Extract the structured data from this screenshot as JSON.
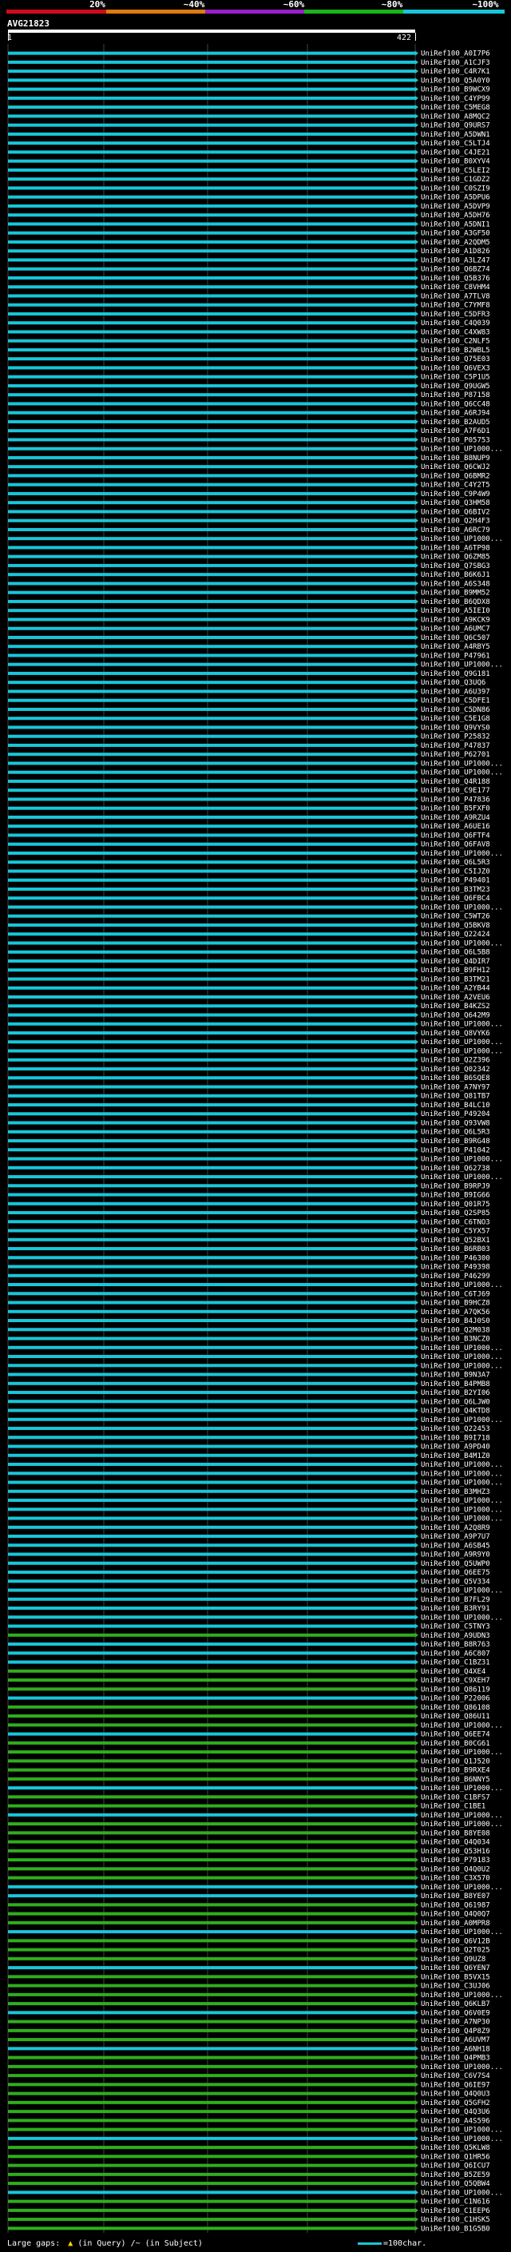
{
  "header": {
    "percent_labels": [
      "20%",
      "~40%",
      "~60%",
      "~80%",
      "~100%"
    ],
    "band_colors": [
      "#d20a1e",
      "#e07a10",
      "#9a1fc8",
      "#1bb31b",
      "#18c6d8"
    ],
    "query_name": "AVG21823",
    "query_start": "1",
    "query_end": "422"
  },
  "colors": {
    "cyan": "#18c6d8",
    "green": "#2fae1d",
    "dim": "#1c3f0e",
    "white": "#ffffff"
  },
  "hits": [
    {
      "name": "UniRef100_A0I7P6",
      "c": "c"
    },
    {
      "name": "UniRef100_A1CJF3",
      "c": "c"
    },
    {
      "name": "UniRef100_C4R7K1",
      "c": "c"
    },
    {
      "name": "UniRef100_Q5A0Y0",
      "c": "c"
    },
    {
      "name": "UniRef100_B9WCX9",
      "c": "c"
    },
    {
      "name": "UniRef100_C4YP99",
      "c": "c"
    },
    {
      "name": "UniRef100_C5MEG8",
      "c": "c"
    },
    {
      "name": "UniRef100_A8MQC2",
      "c": "c"
    },
    {
      "name": "UniRef100_Q9URS7",
      "c": "c"
    },
    {
      "name": "UniRef100_A5DWN1",
      "c": "c"
    },
    {
      "name": "UniRef100_C5LTJ4",
      "c": "c"
    },
    {
      "name": "UniRef100_C4JE21",
      "c": "c"
    },
    {
      "name": "UniRef100_B0XYV4",
      "c": "c"
    },
    {
      "name": "UniRef100_C5LEI2",
      "c": "c"
    },
    {
      "name": "UniRef100_C1GDZ2",
      "c": "c"
    },
    {
      "name": "UniRef100_C0SZI9",
      "c": "c"
    },
    {
      "name": "UniRef100_A5DPU6",
      "c": "c"
    },
    {
      "name": "UniRef100_A5DVP9",
      "c": "c"
    },
    {
      "name": "UniRef100_A5DH76",
      "c": "c"
    },
    {
      "name": "UniRef100_A5DNI1",
      "c": "c"
    },
    {
      "name": "UniRef100_A3GF50",
      "c": "c"
    },
    {
      "name": "UniRef100_A2QDM5",
      "c": "c"
    },
    {
      "name": "UniRef100_A1D826",
      "c": "c"
    },
    {
      "name": "UniRef100_A3LZ47",
      "c": "c"
    },
    {
      "name": "UniRef100_Q6BZ74",
      "c": "c"
    },
    {
      "name": "UniRef100_Q5B376",
      "c": "c"
    },
    {
      "name": "UniRef100_C8VHM4",
      "c": "c"
    },
    {
      "name": "UniRef100_A7TLV8",
      "c": "c"
    },
    {
      "name": "UniRef100_C7YMF8",
      "c": "c"
    },
    {
      "name": "UniRef100_C5DFR3",
      "c": "c"
    },
    {
      "name": "UniRef100_C4Q039",
      "c": "c"
    },
    {
      "name": "UniRef100_C4XW83",
      "c": "c"
    },
    {
      "name": "UniRef100_C2NLF5",
      "c": "c"
    },
    {
      "name": "UniRef100_B2WBL5",
      "c": "c"
    },
    {
      "name": "UniRef100_Q75E03",
      "c": "c"
    },
    {
      "name": "UniRef100_Q6VEX3",
      "c": "c"
    },
    {
      "name": "UniRef100_C5P1U5",
      "c": "c"
    },
    {
      "name": "UniRef100_Q9UGW5",
      "c": "c"
    },
    {
      "name": "UniRef100_P87158",
      "c": "c"
    },
    {
      "name": "UniRef100_Q6CC48",
      "c": "c"
    },
    {
      "name": "UniRef100_A6RJ94",
      "c": "c"
    },
    {
      "name": "UniRef100_B2AUD5",
      "c": "c"
    },
    {
      "name": "UniRef100_A7F6D1",
      "c": "c"
    },
    {
      "name": "UniRef100_P05753",
      "c": "c"
    },
    {
      "name": "UniRef100_UP1000...",
      "c": "c"
    },
    {
      "name": "UniRef100_B8NUP9",
      "c": "c"
    },
    {
      "name": "UniRef100_Q6CWJ2",
      "c": "c"
    },
    {
      "name": "UniRef100_Q6BMR2",
      "c": "c"
    },
    {
      "name": "UniRef100_C4Y2T5",
      "c": "c"
    },
    {
      "name": "UniRef100_C9P4W9",
      "c": "c"
    },
    {
      "name": "UniRef100_Q3HM58",
      "c": "c"
    },
    {
      "name": "UniRef100_Q6BIV2",
      "c": "c"
    },
    {
      "name": "UniRef100_Q2H4F3",
      "c": "c"
    },
    {
      "name": "UniRef100_A6RC79",
      "c": "c"
    },
    {
      "name": "UniRef100_UP1000...",
      "c": "c"
    },
    {
      "name": "UniRef100_A6TP98",
      "c": "c"
    },
    {
      "name": "UniRef100_Q6ZM85",
      "c": "c"
    },
    {
      "name": "UniRef100_Q7SBG3",
      "c": "c"
    },
    {
      "name": "UniRef100_B6K6J1",
      "c": "c"
    },
    {
      "name": "UniRef100_A6S348",
      "c": "c"
    },
    {
      "name": "UniRef100_B9MM52",
      "c": "c"
    },
    {
      "name": "UniRef100_B6QDX8",
      "c": "c"
    },
    {
      "name": "UniRef100_A5IEI0",
      "c": "c"
    },
    {
      "name": "UniRef100_A9KCK9",
      "c": "c"
    },
    {
      "name": "UniRef100_A6UMC7",
      "c": "c"
    },
    {
      "name": "UniRef100_Q6C507",
      "c": "c"
    },
    {
      "name": "UniRef100_A4RBY5",
      "c": "c"
    },
    {
      "name": "UniRef100_P47961",
      "c": "c"
    },
    {
      "name": "UniRef100_UP1000...",
      "c": "c"
    },
    {
      "name": "UniRef100_Q9G181",
      "c": "c"
    },
    {
      "name": "UniRef100_Q3UQ6",
      "c": "c"
    },
    {
      "name": "UniRef100_A6U397",
      "c": "c"
    },
    {
      "name": "UniRef100_C5DFE1",
      "c": "c"
    },
    {
      "name": "UniRef100_C5DN86",
      "c": "c"
    },
    {
      "name": "UniRef100_C5E1G8",
      "c": "c"
    },
    {
      "name": "UniRef100_Q9VYS0",
      "c": "c"
    },
    {
      "name": "UniRef100_P25832",
      "c": "c"
    },
    {
      "name": "UniRef100_P47837",
      "c": "c"
    },
    {
      "name": "UniRef100_P62701",
      "c": "c"
    },
    {
      "name": "UniRef100_UP1000...",
      "c": "c"
    },
    {
      "name": "UniRef100_UP1000...",
      "c": "c"
    },
    {
      "name": "UniRef100_Q4R188",
      "c": "c"
    },
    {
      "name": "UniRef100_C9E177",
      "c": "c"
    },
    {
      "name": "UniRef100_P47836",
      "c": "c"
    },
    {
      "name": "UniRef100_B5FXF0",
      "c": "c"
    },
    {
      "name": "UniRef100_A9RZU4",
      "c": "c"
    },
    {
      "name": "UniRef100_A6UE16",
      "c": "c"
    },
    {
      "name": "UniRef100_Q6FTF4",
      "c": "c"
    },
    {
      "name": "UniRef100_Q6FAV8",
      "c": "c"
    },
    {
      "name": "UniRef100_UP1000...",
      "c": "c"
    },
    {
      "name": "UniRef100_Q6L5R3",
      "c": "c"
    },
    {
      "name": "UniRef100_C5IJZ0",
      "c": "c"
    },
    {
      "name": "UniRef100_P49401",
      "c": "c"
    },
    {
      "name": "UniRef100_B3TM23",
      "c": "c"
    },
    {
      "name": "UniRef100_Q6FBC4",
      "c": "c"
    },
    {
      "name": "UniRef100_UP1000...",
      "c": "c"
    },
    {
      "name": "UniRef100_C5WT26",
      "c": "c"
    },
    {
      "name": "UniRef100_Q5BKV8",
      "c": "c"
    },
    {
      "name": "UniRef100_Q22424",
      "c": "c"
    },
    {
      "name": "UniRef100_UP1000...",
      "c": "c"
    },
    {
      "name": "UniRef100_Q6L5B8",
      "c": "c"
    },
    {
      "name": "UniRef100_Q4DIR7",
      "c": "c"
    },
    {
      "name": "UniRef100_B9FH12",
      "c": "c"
    },
    {
      "name": "UniRef100_B3TM21",
      "c": "c"
    },
    {
      "name": "UniRef100_A2YB44",
      "c": "c"
    },
    {
      "name": "UniRef100_A2VEU6",
      "c": "c"
    },
    {
      "name": "UniRef100_B4KZS2",
      "c": "c"
    },
    {
      "name": "UniRef100_Q642M9",
      "c": "c"
    },
    {
      "name": "UniRef100_UP1000...",
      "c": "c"
    },
    {
      "name": "UniRef100_Q8VYK6",
      "c": "c"
    },
    {
      "name": "UniRef100_UP1000...",
      "c": "c"
    },
    {
      "name": "UniRef100_UP1000...",
      "c": "c"
    },
    {
      "name": "UniRef100_Q2Z396",
      "c": "c"
    },
    {
      "name": "UniRef100_Q02342",
      "c": "c"
    },
    {
      "name": "UniRef100_B6SQE8",
      "c": "c"
    },
    {
      "name": "UniRef100_A7NY97",
      "c": "c"
    },
    {
      "name": "UniRef100_Q81TB7",
      "c": "c"
    },
    {
      "name": "UniRef100_B4LC10",
      "c": "c"
    },
    {
      "name": "UniRef100_P49204",
      "c": "c"
    },
    {
      "name": "UniRef100_Q93VW8",
      "c": "c"
    },
    {
      "name": "UniRef100_Q6L5R3",
      "c": "c"
    },
    {
      "name": "UniRef100_B9RG48",
      "c": "c"
    },
    {
      "name": "UniRef100_P41042",
      "c": "c"
    },
    {
      "name": "UniRef100_UP1000...",
      "c": "c"
    },
    {
      "name": "UniRef100_Q62738",
      "c": "c"
    },
    {
      "name": "UniRef100_UP1000...",
      "c": "c"
    },
    {
      "name": "UniRef100_B9RPJ9",
      "c": "c"
    },
    {
      "name": "UniRef100_B9IG66",
      "c": "c"
    },
    {
      "name": "UniRef100_Q01R75",
      "c": "c"
    },
    {
      "name": "UniRef100_Q2SP85",
      "c": "c"
    },
    {
      "name": "UniRef100_C6TNO3",
      "c": "c"
    },
    {
      "name": "UniRef100_C5YX57",
      "c": "c"
    },
    {
      "name": "UniRef100_Q52BX1",
      "c": "c"
    },
    {
      "name": "UniRef100_B6RB03",
      "c": "c"
    },
    {
      "name": "UniRef100_P46300",
      "c": "c"
    },
    {
      "name": "UniRef100_P49398",
      "c": "c"
    },
    {
      "name": "UniRef100_P46299",
      "c": "c"
    },
    {
      "name": "UniRef100_UP1000...",
      "c": "c"
    },
    {
      "name": "UniRef100_C6TJ69",
      "c": "c"
    },
    {
      "name": "UniRef100_B9HCZ8",
      "c": "c"
    },
    {
      "name": "UniRef100_A7QK56",
      "c": "c"
    },
    {
      "name": "UniRef100_B4J0S0",
      "c": "c"
    },
    {
      "name": "UniRef100_Q2M038",
      "c": "c"
    },
    {
      "name": "UniRef100_B3NCZ0",
      "c": "c"
    },
    {
      "name": "UniRef100_UP1000...",
      "c": "c"
    },
    {
      "name": "UniRef100_UP1000...",
      "c": "c"
    },
    {
      "name": "UniRef100_UP1000...",
      "c": "c"
    },
    {
      "name": "UniRef100_B9N3A7",
      "c": "c"
    },
    {
      "name": "UniRef100_B4PMB8",
      "c": "c"
    },
    {
      "name": "UniRef100_B2YI06",
      "c": "c"
    },
    {
      "name": "UniRef100_Q6LJW0",
      "c": "c"
    },
    {
      "name": "UniRef100_Q4KTD8",
      "c": "c"
    },
    {
      "name": "UniRef100_UP1000...",
      "c": "c"
    },
    {
      "name": "UniRef100_Q22453",
      "c": "c"
    },
    {
      "name": "UniRef100_B9I718",
      "c": "c"
    },
    {
      "name": "UniRef100_A9PD40",
      "c": "c"
    },
    {
      "name": "UniRef100_B4M1Z0",
      "c": "c"
    },
    {
      "name": "UniRef100_UP1000...",
      "c": "c"
    },
    {
      "name": "UniRef100_UP1000...",
      "c": "c"
    },
    {
      "name": "UniRef100_UP1000...",
      "c": "c"
    },
    {
      "name": "UniRef100_B3MHZ3",
      "c": "c"
    },
    {
      "name": "UniRef100_UP1000...",
      "c": "c"
    },
    {
      "name": "UniRef100_UP1000...",
      "c": "c"
    },
    {
      "name": "UniRef100_UP1000...",
      "c": "c"
    },
    {
      "name": "UniRef100_A2Q8R9",
      "c": "c"
    },
    {
      "name": "UniRef100_A9P7U7",
      "c": "c"
    },
    {
      "name": "UniRef100_A6SB45",
      "c": "c"
    },
    {
      "name": "UniRef100_A9R9Y0",
      "c": "c"
    },
    {
      "name": "UniRef100_Q5UWP0",
      "c": "c"
    },
    {
      "name": "UniRef100_Q6EE75",
      "c": "c"
    },
    {
      "name": "UniRef100_Q5V334",
      "c": "c"
    },
    {
      "name": "UniRef100_UP1000...",
      "c": "c"
    },
    {
      "name": "UniRef100_B7FL29",
      "c": "c"
    },
    {
      "name": "UniRef100_B3RY91",
      "c": "c"
    },
    {
      "name": "UniRef100_UP1000...",
      "c": "c"
    },
    {
      "name": "UniRef100_C5TNY3",
      "c": "c"
    },
    {
      "name": "UniRef100_A9UDN3",
      "c": "g"
    },
    {
      "name": "UniRef100_B8R763",
      "c": "c"
    },
    {
      "name": "UniRef100_A6C807",
      "c": "c"
    },
    {
      "name": "UniRef100_C1BZ31",
      "c": "c"
    },
    {
      "name": "UniRef100_Q4XE4",
      "c": "g"
    },
    {
      "name": "UniRef100_C9XEH7",
      "c": "g"
    },
    {
      "name": "UniRef100_Q86119",
      "c": "g"
    },
    {
      "name": "UniRef100_P22006",
      "c": "c"
    },
    {
      "name": "UniRef100_Q86108",
      "c": "g"
    },
    {
      "name": "UniRef100_Q86U11",
      "c": "g"
    },
    {
      "name": "UniRef100_UP1000...",
      "c": "g"
    },
    {
      "name": "UniRef100_Q6EE74",
      "c": "c"
    },
    {
      "name": "UniRef100_B0CG61",
      "c": "g"
    },
    {
      "name": "UniRef100_UP1000...",
      "c": "g"
    },
    {
      "name": "UniRef100_Q1J520",
      "c": "g"
    },
    {
      "name": "UniRef100_B9RXE4",
      "c": "g"
    },
    {
      "name": "UniRef100_B6NNY5",
      "c": "g"
    },
    {
      "name": "UniRef100_UP1000...",
      "c": "c"
    },
    {
      "name": "UniRef100_C1BFS7",
      "c": "g"
    },
    {
      "name": "UniRef100_C1BE1",
      "c": "g"
    },
    {
      "name": "UniRef100_UP1000...",
      "c": "c"
    },
    {
      "name": "UniRef100_UP1000...",
      "c": "g"
    },
    {
      "name": "UniRef100_B8YE08",
      "c": "g"
    },
    {
      "name": "UniRef100_Q4Q034",
      "c": "g"
    },
    {
      "name": "UniRef100_Q53H16",
      "c": "g"
    },
    {
      "name": "UniRef100_P79183",
      "c": "g"
    },
    {
      "name": "UniRef100_Q4Q0U2",
      "c": "g"
    },
    {
      "name": "UniRef100_C3X570",
      "c": "g"
    },
    {
      "name": "UniRef100_UP1000...",
      "c": "c"
    },
    {
      "name": "UniRef100_B8YE07",
      "c": "c"
    },
    {
      "name": "UniRef100_Q61987",
      "c": "g"
    },
    {
      "name": "UniRef100_Q4Q0Q7",
      "c": "g"
    },
    {
      "name": "UniRef100_A0MPR8",
      "c": "g"
    },
    {
      "name": "UniRef100_UP1000...",
      "c": "c"
    },
    {
      "name": "UniRef100_Q6V12B",
      "c": "g"
    },
    {
      "name": "UniRef100_Q2T025",
      "c": "g"
    },
    {
      "name": "UniRef100_Q9UZ8",
      "c": "g"
    },
    {
      "name": "UniRef100_Q6YEN7",
      "c": "c"
    },
    {
      "name": "UniRef100_B5VX15",
      "c": "g"
    },
    {
      "name": "UniRef100_C3UJ06",
      "c": "g"
    },
    {
      "name": "UniRef100_UP1000...",
      "c": "g"
    },
    {
      "name": "UniRef100_Q6KLB7",
      "c": "g"
    },
    {
      "name": "UniRef100_Q6V0E9",
      "c": "c"
    },
    {
      "name": "UniRef100_A7NP30",
      "c": "g"
    },
    {
      "name": "UniRef100_Q4P8Z9",
      "c": "g"
    },
    {
      "name": "UniRef100_A6UVM7",
      "c": "g"
    },
    {
      "name": "UniRef100_A6NH18",
      "c": "c"
    },
    {
      "name": "UniRef100_Q4PMB3",
      "c": "g"
    },
    {
      "name": "UniRef100_UP1000...",
      "c": "g"
    },
    {
      "name": "UniRef100_C6V7S4",
      "c": "g"
    },
    {
      "name": "UniRef100_Q6IE97",
      "c": "g"
    },
    {
      "name": "UniRef100_Q4Q0U3",
      "c": "g"
    },
    {
      "name": "UniRef100_Q5GFH2",
      "c": "g"
    },
    {
      "name": "UniRef100_Q4Q3U6",
      "c": "g"
    },
    {
      "name": "UniRef100_A4S596",
      "c": "g"
    },
    {
      "name": "UniRef100_UP1000...",
      "c": "g"
    },
    {
      "name": "UniRef100_UP1000...",
      "c": "c"
    },
    {
      "name": "UniRef100_Q5KLW8",
      "c": "g"
    },
    {
      "name": "UniRef100_Q1HR56",
      "c": "g"
    },
    {
      "name": "UniRef100_Q6ICU7",
      "c": "g"
    },
    {
      "name": "UniRef100_B5ZE59",
      "c": "g"
    },
    {
      "name": "UniRef100_Q5QBW4",
      "c": "g"
    },
    {
      "name": "UniRef100_UP1000...",
      "c": "c"
    },
    {
      "name": "UniRef100_C1N616",
      "c": "g"
    },
    {
      "name": "UniRef100_C1EEP6",
      "c": "g"
    },
    {
      "name": "UniRef100_C1HSK5",
      "c": "g"
    },
    {
      "name": "UniRef100_B1G5B0",
      "c": "g"
    }
  ],
  "footer": {
    "large_gaps_label": "Large gaps:",
    "in_query": "(in Query)",
    "sep": "/~",
    "in_subject": "(in Subject)",
    "scale_label": "=100char."
  }
}
